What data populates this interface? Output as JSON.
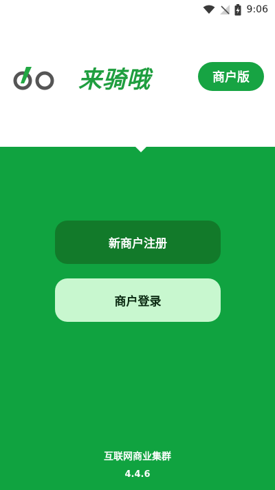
{
  "status_bar": {
    "time": "9:06",
    "icons": [
      "wifi-icon",
      "signal-off-icon",
      "battery-charging-icon"
    ]
  },
  "header": {
    "brand_name": "来骑哦",
    "badge_label": "商户版"
  },
  "actions": {
    "register_label": "新商户注册",
    "login_label": "商户登录"
  },
  "footer": {
    "company": "互联网商业集群",
    "version": "4.4.6"
  },
  "colors": {
    "brand_green": "#10a340",
    "register_button": "#127a2a",
    "login_button": "#c8f7cf"
  }
}
